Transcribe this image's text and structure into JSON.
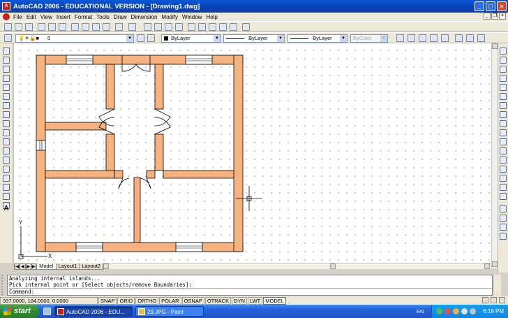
{
  "window": {
    "title": "AutoCAD 2006 - EDUCATIONAL VERSION - [Drawing1.dwg]",
    "app_icon_text": "A",
    "minimize_glyph": "_",
    "maximize_glyph": "□",
    "close_glyph": "×",
    "doc_minimize_glyph": "_",
    "doc_restore_glyph": "❐",
    "doc_close_glyph": "×"
  },
  "menu": {
    "items": [
      "File",
      "Edit",
      "View",
      "Insert",
      "Format",
      "Tools",
      "Draw",
      "Dimension",
      "Modify",
      "Window",
      "Help"
    ]
  },
  "toolbar2": {
    "layer_value": "0",
    "color_value": "ByLayer",
    "linetype_value": "ByLayer",
    "lineweight_value": "ByLayer",
    "plotstyle_value": "ByColor",
    "dropdown_glyph": "▼"
  },
  "layout_tabs": {
    "nav_first": "|◀",
    "nav_prev": "◀",
    "nav_next": "▶",
    "nav_last": "▶|",
    "tabs": [
      "Model",
      "Layout1",
      "Layout2"
    ]
  },
  "ucs": {
    "x_label": "X",
    "y_label": "Y"
  },
  "side_left": {
    "text_tool_label": "A"
  },
  "command": {
    "lines": [
      "Analyzing internal islands...",
      "Pick internal point or [Select objects/remove Boundaries]:"
    ],
    "prompt": "Command:"
  },
  "status": {
    "coordinates": "337.0000, 104.0000, 0.0000",
    "buttons": [
      "SNAP",
      "GRID",
      "ORTHO",
      "POLAR",
      "OSNAP",
      "OTRACK",
      "DYN",
      "LWT",
      "MODEL"
    ]
  },
  "taskbar": {
    "start_label": "start",
    "tasks": [
      {
        "label": "AutoCAD 2006 - EDU...",
        "active": true
      },
      {
        "label": "29.JPG - Paint",
        "active": false
      }
    ],
    "language": "EN",
    "clock": "6:19 PM"
  },
  "colors": {
    "wall_fill": "#f5b27f",
    "wall_stroke": "#000000",
    "titlebar": "#0842b4",
    "taskbar": "#2564de"
  }
}
